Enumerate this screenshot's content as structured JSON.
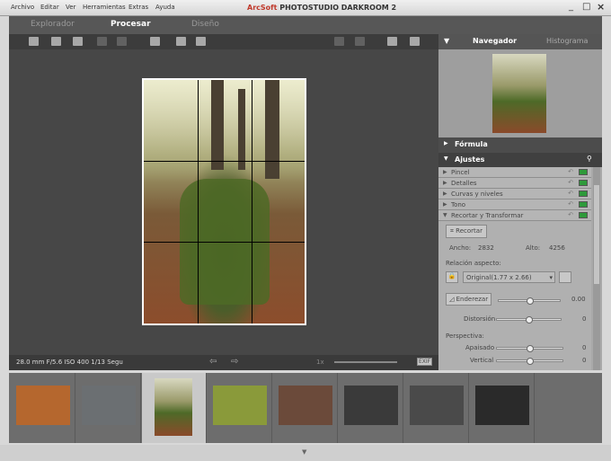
{
  "menu": [
    "Archivo",
    "Editar",
    "Ver",
    "Herramientas",
    "Extras",
    "Ayuda"
  ],
  "app_title_brand": "ArcSoft",
  "app_title": "PHOTOSTUDIO DARKROOM 2",
  "window_controls": {
    "minimize": "_",
    "maximize": "□",
    "close": "×"
  },
  "tabs": [
    "Explorador",
    "Procesar",
    "Diseño"
  ],
  "status": {
    "exif": "28.0 mm  F/5.6  ISO 400  1/13 Segu",
    "zoom": "1x",
    "exif_button": "EXIF"
  },
  "right_tabs": [
    "Navegador",
    "Histograma"
  ],
  "panels": {
    "formula": "Fórmula",
    "ajustes": "Ajustes"
  },
  "adjust_rows": [
    "Pincel",
    "Detalles",
    "Curvas y niveles",
    "Tono",
    "Recortar y Transformar"
  ],
  "crop": {
    "button": "Recortar",
    "width_label": "Ancho:",
    "width": "2832",
    "height_label": "Alto:",
    "height": "4256",
    "aspect_label": "Relación aspecto:",
    "aspect_value": "Original(1.77 x 2.66)",
    "straighten": "Enderezar",
    "straighten_value": "0.00",
    "distortion": "Distorsión",
    "distortion_value": "0",
    "perspective": "Perspectiva:",
    "flatten": "Apaisado",
    "flatten_value": "0",
    "vertical": "Vertical",
    "vertical_value": "0"
  },
  "sliders": {
    "straighten": 0.5,
    "distortion": 0.5,
    "flatten": 0.5,
    "vertical": 0.5,
    "zoom": 0.9
  },
  "thumb_colors": [
    "#b5672e",
    "#6b6f72",
    "#6b5a3a",
    "#8a9a3a",
    "#6b4a3a",
    "#3a3a3a",
    "#4a4a4a",
    "#2a2a2a"
  ]
}
